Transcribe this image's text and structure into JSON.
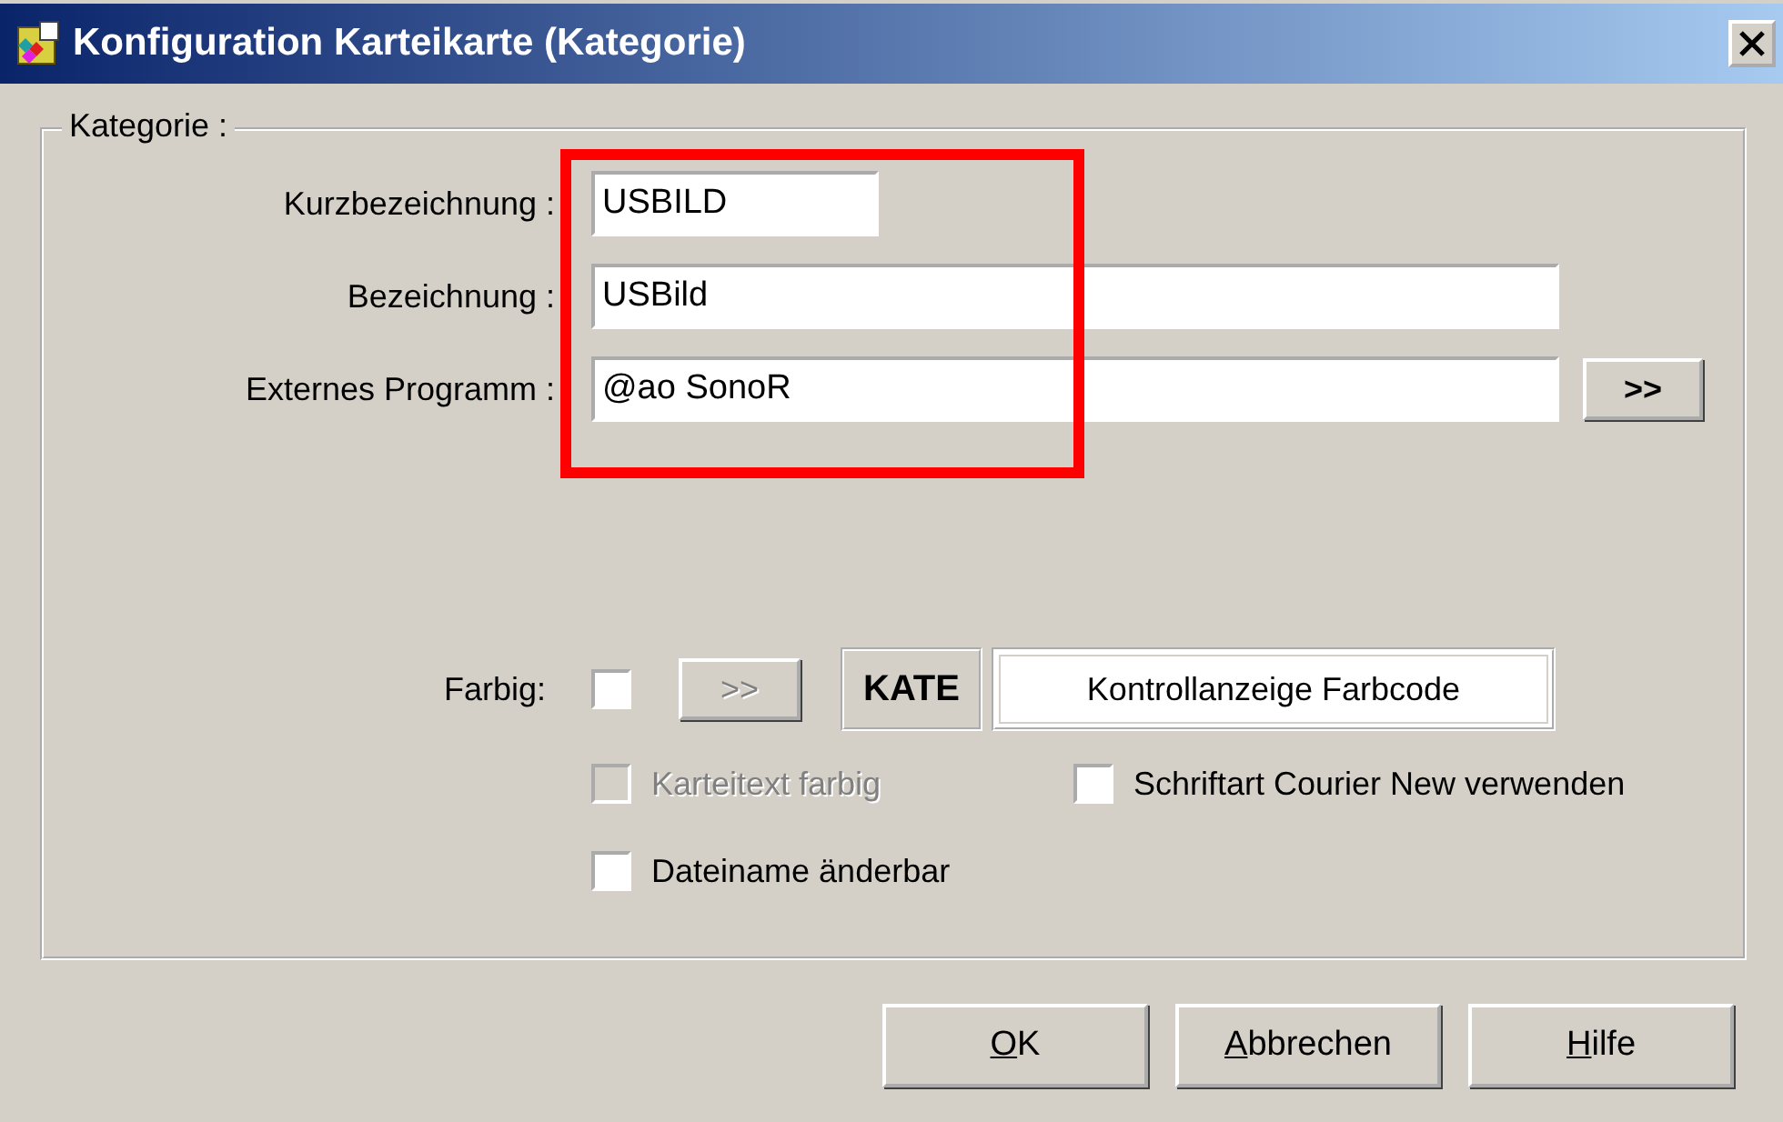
{
  "window": {
    "title": "Konfiguration Karteikarte (Kategorie)"
  },
  "group": {
    "legend": "Kategorie :",
    "fields": [
      {
        "label": "Kurzbezeichnung :",
        "value": "USBILD",
        "kind": "short"
      },
      {
        "label": "Bezeichnung :",
        "value": "USBild",
        "kind": "long"
      },
      {
        "label": "Externes Programm :",
        "value": "@ao SonoR",
        "kind": "browse",
        "button": ">>"
      }
    ]
  },
  "farbig": {
    "label": "Farbig:",
    "checked": false,
    "button": {
      "label": ">>",
      "disabled": true
    },
    "code": "KATE",
    "preview": "Kontrollanzeige Farbcode"
  },
  "options": [
    {
      "label": "Karteitext farbig",
      "checked": false,
      "disabled": true
    },
    {
      "label": "Schriftart Courier New verwenden",
      "checked": false,
      "disabled": false
    },
    {
      "label": "Dateiname änderbar",
      "checked": false,
      "disabled": false
    }
  ],
  "buttons": [
    {
      "label": "OK",
      "mnemonic_first": true
    },
    {
      "label": "Abbrechen",
      "mnemonic_first": true
    },
    {
      "label": "Hilfe",
      "mnemonic_first": true
    }
  ],
  "annotation": {
    "kind": "rectangle"
  }
}
